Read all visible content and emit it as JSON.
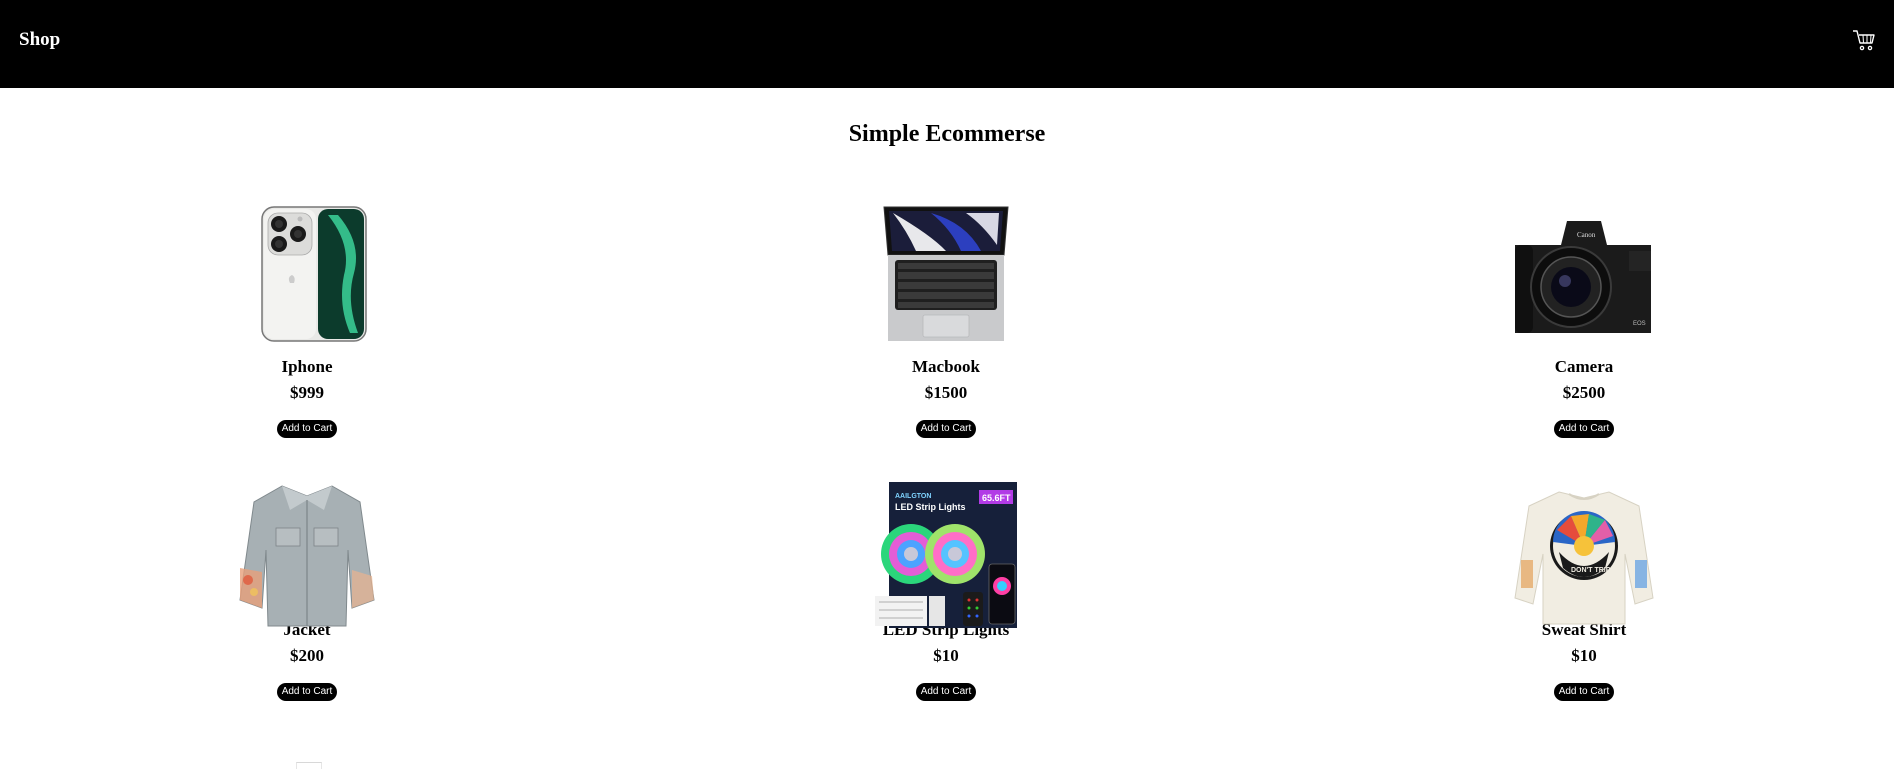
{
  "navbar": {
    "brand": "Shop",
    "cart_icon": "shopping-cart-icon"
  },
  "page_title": "Simple Ecommerse",
  "products": [
    {
      "name": "Iphone",
      "price": "$999",
      "button": "Add to Cart",
      "image": "iphone-image"
    },
    {
      "name": "Macbook",
      "price": "$1500",
      "button": "Add to Cart",
      "image": "macbook-image"
    },
    {
      "name": "Camera",
      "price": "$2500",
      "button": "Add to Cart",
      "image": "camera-image"
    },
    {
      "name": "Jacket",
      "price": "$200",
      "button": "Add to Cart",
      "image": "jacket-image"
    },
    {
      "name": "LED Strip Lights",
      "price": "$10",
      "button": "Add to Cart",
      "image": "led-strip-lights-image"
    },
    {
      "name": "Sweat Shirt",
      "price": "$10",
      "button": "Add to Cart",
      "image": "sweat-shirt-image"
    }
  ],
  "colors": {
    "navbar_bg": "#000000",
    "button_bg": "#000000",
    "button_text": "#ffffff",
    "page_bg": "#ffffff"
  }
}
